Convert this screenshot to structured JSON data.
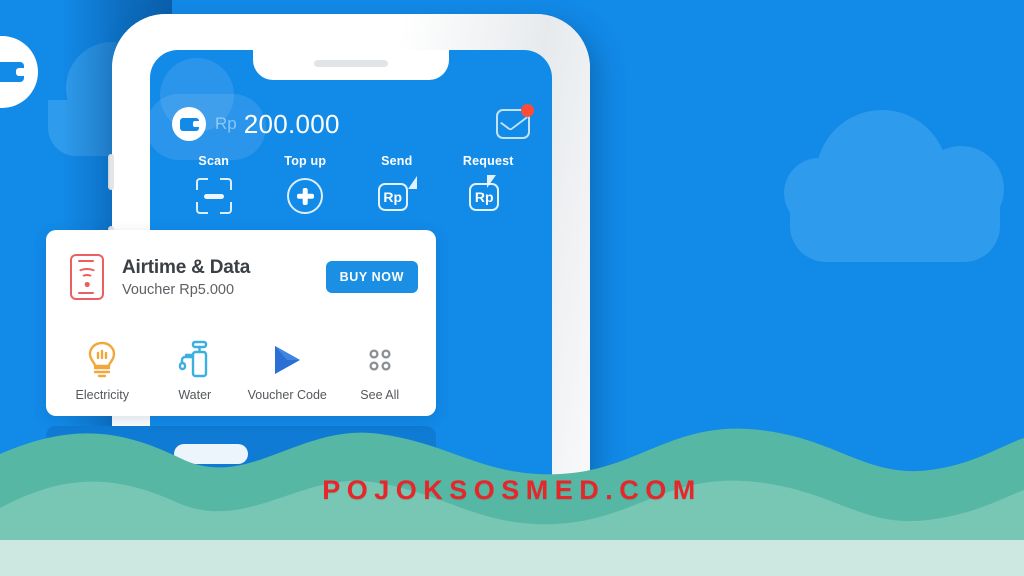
{
  "brand": {
    "watermark": "POJOKSOSMED.COM",
    "watermark_color": "#E8262A",
    "background_color": "#128AE8",
    "accent_color": "#1A8FE3",
    "wave_back_color": "#56B8A4",
    "wave_front_color": "#78C7B4",
    "mint_strip_color": "#CDE8E0"
  },
  "phone": {
    "header": {
      "wallet_icon": "wallet-icon",
      "currency_prefix": "Rp",
      "balance": "200.000",
      "mail_icon": "mail-icon",
      "has_unread_badge": true,
      "badge_color": "#FF4C38"
    },
    "quick_actions": [
      {
        "label": "Scan",
        "icon": "scan-icon"
      },
      {
        "label": "Top up",
        "icon": "plus-circle-icon"
      },
      {
        "label": "Send",
        "icon": "send-money-icon"
      },
      {
        "label": "Request",
        "icon": "request-money-icon"
      }
    ],
    "promo_card": {
      "icon": "sim-wifi-icon",
      "title": "Airtime & Data",
      "subtitle": "Voucher Rp5.000",
      "button_label": "BUY NOW"
    },
    "services": [
      {
        "label": "Electricity",
        "icon": "lightbulb-icon",
        "color": "#F2A73B"
      },
      {
        "label": "Water",
        "icon": "faucet-icon",
        "color": "#3AAFE0"
      },
      {
        "label": "Voucher Code",
        "icon": "play-triangle-icon",
        "color": "#2B6FD4"
      },
      {
        "label": "See All",
        "icon": "grid-dots-icon",
        "color": "#8A8F94"
      }
    ]
  }
}
